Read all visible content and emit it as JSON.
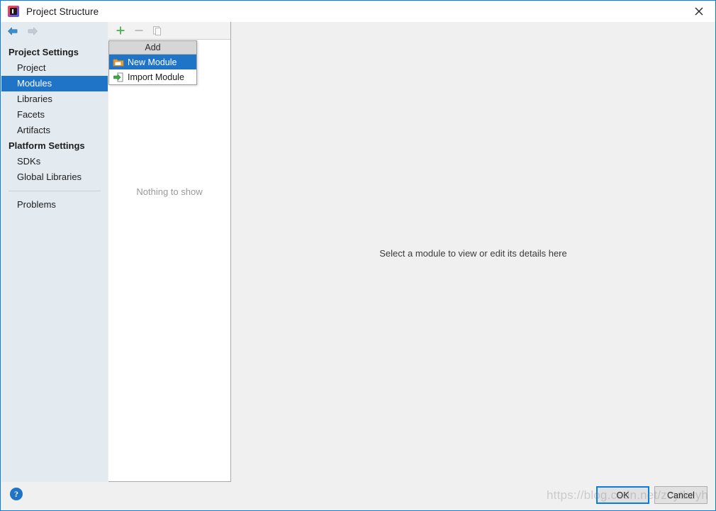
{
  "window": {
    "title": "Project Structure",
    "app_icon": "intellij-idea-icon",
    "close_label": "✕"
  },
  "sidebar": {
    "back_label": "back-arrow",
    "forward_label": "forward-arrow",
    "sections": [
      {
        "group": "Project Settings",
        "items": [
          {
            "label": "Project",
            "selected": false
          },
          {
            "label": "Modules",
            "selected": true
          },
          {
            "label": "Libraries",
            "selected": false
          },
          {
            "label": "Facets",
            "selected": false
          },
          {
            "label": "Artifacts",
            "selected": false
          }
        ]
      },
      {
        "group": "Platform Settings",
        "items": [
          {
            "label": "SDKs",
            "selected": false
          },
          {
            "label": "Global Libraries",
            "selected": false
          }
        ]
      }
    ],
    "extra_items": [
      {
        "label": "Problems",
        "selected": false
      }
    ]
  },
  "middle_panel": {
    "toolbar": {
      "add_icon": "plus-icon",
      "remove_icon": "minus-icon",
      "copy_icon": "copy-icon"
    },
    "empty_text": "Nothing to show"
  },
  "add_popup": {
    "header": "Add",
    "items": [
      {
        "label": "New Module",
        "icon": "new-folder-icon",
        "selected": true
      },
      {
        "label": "Import Module",
        "icon": "import-arrow-icon",
        "selected": false
      }
    ]
  },
  "detail_panel": {
    "hint": "Select a module to view or edit its details here"
  },
  "footer": {
    "help_label": "?",
    "ok_label": "OK",
    "cancel_label": "Cancel"
  },
  "watermark": {
    "text": "https://blog.csdn.net/zcytkzyh"
  },
  "colors": {
    "accent": "#1f74c8",
    "window_border": "#0a7de0",
    "sidebar_bg": "#e3eaf0",
    "panel_bg": "#f0f0f0",
    "add_icon_green": "#4caf50"
  }
}
